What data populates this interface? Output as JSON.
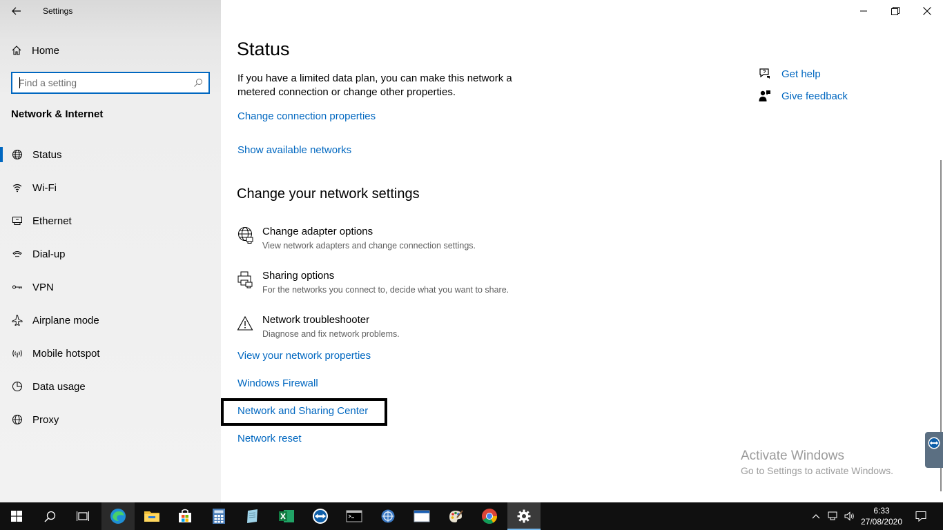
{
  "window": {
    "title": "Settings",
    "controls": [
      "minimize",
      "restore",
      "close"
    ]
  },
  "sidebar": {
    "home_label": "Home",
    "search_placeholder": "Find a setting",
    "section_title": "Network & Internet",
    "items": [
      {
        "label": "Status",
        "icon": "globe-status-icon",
        "active": true
      },
      {
        "label": "Wi-Fi",
        "icon": "wifi-icon",
        "active": false
      },
      {
        "label": "Ethernet",
        "icon": "ethernet-icon",
        "active": false
      },
      {
        "label": "Dial-up",
        "icon": "dialup-icon",
        "active": false
      },
      {
        "label": "VPN",
        "icon": "vpn-icon",
        "active": false
      },
      {
        "label": "Airplane mode",
        "icon": "airplane-icon",
        "active": false
      },
      {
        "label": "Mobile hotspot",
        "icon": "hotspot-icon",
        "active": false
      },
      {
        "label": "Data usage",
        "icon": "data-usage-icon",
        "active": false
      },
      {
        "label": "Proxy",
        "icon": "globe-icon",
        "active": false
      }
    ]
  },
  "main": {
    "title": "Status",
    "intro": "If you have a limited data plan, you can make this network a metered connection or change other properties.",
    "links_top": {
      "change_connection": "Change connection properties",
      "show_networks": "Show available networks"
    },
    "change_heading": "Change your network settings",
    "options": [
      {
        "title": "Change adapter options",
        "desc": "View network adapters and change connection settings.",
        "icon": "adapter-icon"
      },
      {
        "title": "Sharing options",
        "desc": "For the networks you connect to, decide what you want to share.",
        "icon": "sharing-icon"
      },
      {
        "title": "Network troubleshooter",
        "desc": "Diagnose and fix network problems.",
        "icon": "warning-icon"
      }
    ],
    "links_bottom": {
      "view_properties": "View your network properties",
      "firewall": "Windows Firewall",
      "sharing_center": "Network and Sharing Center",
      "reset": "Network reset"
    }
  },
  "help": {
    "get_help": "Get help",
    "give_feedback": "Give feedback"
  },
  "watermark": {
    "line1": "Activate Windows",
    "line2": "Go to Settings to activate Windows."
  },
  "taskbar": {
    "apps": [
      "start",
      "search",
      "task-view",
      "edge",
      "file-explorer",
      "store",
      "calculator",
      "notepad",
      "excel",
      "teamviewer",
      "terminal",
      "tool",
      "window",
      "paint",
      "chrome",
      "settings"
    ],
    "active_app": "settings",
    "time": "6:33",
    "date": "27/08/2020"
  },
  "colors": {
    "accent": "#0067c0",
    "taskbar": "#101010",
    "sidebar": "#f2f2f2",
    "watermark": "#9b9b9b"
  }
}
